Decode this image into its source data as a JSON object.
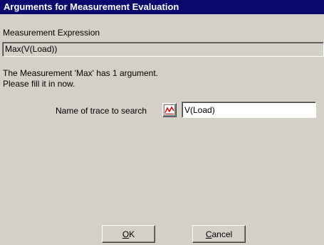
{
  "window": {
    "title": "Arguments for Measurement Evaluation"
  },
  "expression": {
    "label": "Measurement Expression",
    "value": "Max(V(Load))"
  },
  "info": {
    "line1": "The Measurement 'Max' has 1 argument.",
    "line2": "Please fill it in now."
  },
  "argument": {
    "label": "Name of trace to search",
    "value": "V(Load)",
    "icon": "trace-graph-icon"
  },
  "buttons": {
    "ok": {
      "mnemonic": "O",
      "rest": "K"
    },
    "cancel": {
      "mnemonic": "C",
      "rest": "ancel"
    }
  },
  "colors": {
    "title_bar": "#0a0a6e",
    "face": "#d4d0c8",
    "icon_trace": "#d40000"
  }
}
